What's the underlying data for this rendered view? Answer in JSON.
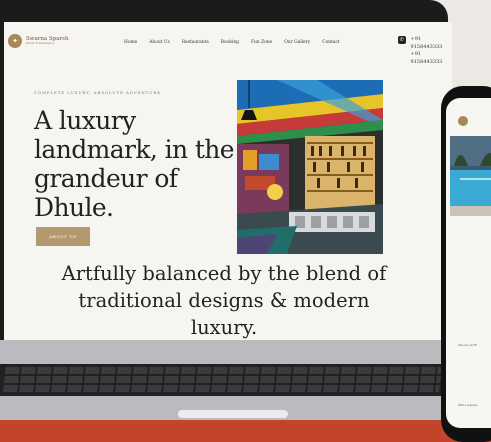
{
  "nav": {
    "logo_name": "Swarna Sparsh",
    "logo_sub": "Hotel & Residency",
    "links": [
      "Home",
      "About Us",
      "Restaurants",
      "Booking",
      "Fun Zone",
      "Our Gallery",
      "Contact"
    ],
    "phones": [
      "+91 9158443333",
      "+91 9158443333"
    ]
  },
  "hero": {
    "eyebrow": "COMPLETE LUXURY, ABSOLUTE ADVENTURE",
    "headline": "A luxury landmark, in the grandeur of Dhule.",
    "button": "ABOUT US",
    "tagline": "Artfully balanced by the blend of traditional designs & modern luxury."
  },
  "phone": {
    "line1": "Give me our Ri",
    "line2": "With a capacity"
  },
  "colors": {
    "accent": "#b39a6e",
    "floor": "#c2452a"
  }
}
